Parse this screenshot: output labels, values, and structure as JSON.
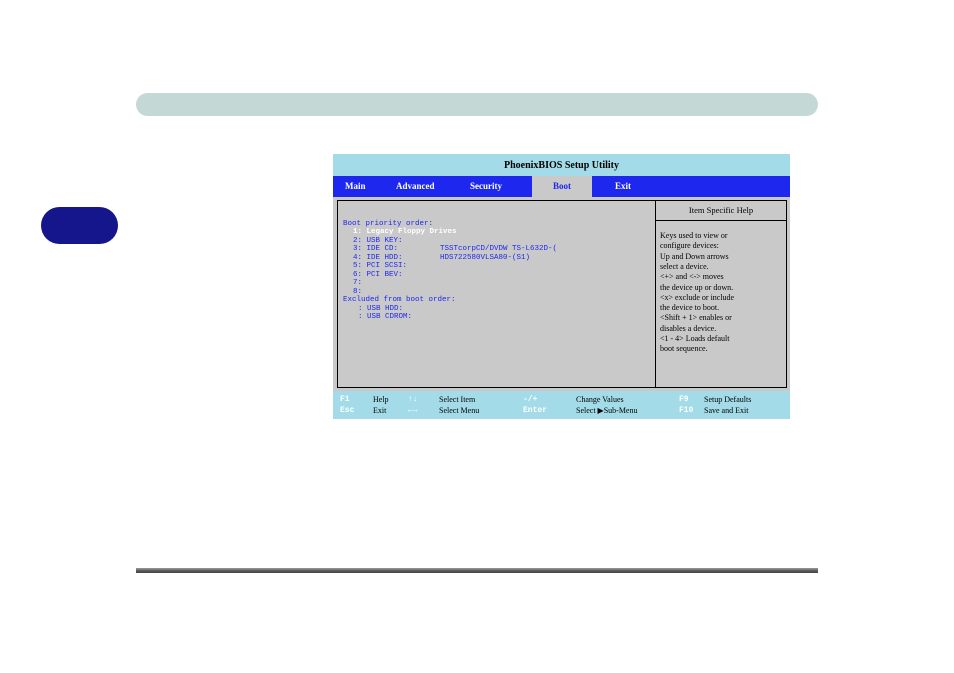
{
  "bios": {
    "title": "PhoenixBIOS Setup Utility",
    "menu": [
      {
        "label": "Main"
      },
      {
        "label": "Advanced"
      },
      {
        "label": "Security"
      },
      {
        "label": "Boot"
      },
      {
        "label": "Exit"
      }
    ],
    "active_menu": "Boot",
    "boot": {
      "priority_header": "Boot priority order:",
      "items": [
        {
          "label": "1:  Legacy Floppy Drives",
          "value": ""
        },
        {
          "label": "2:  USB KEY:",
          "value": ""
        },
        {
          "label": "3:  IDE CD:",
          "value": "TSSTcorpCD/DVDW TS-L632D-("
        },
        {
          "label": "4:  IDE HDD:",
          "value": "HDS722580VLSA80-(S1)"
        },
        {
          "label": "5:  PCI SCSI:",
          "value": ""
        },
        {
          "label": "6:  PCI BEV:",
          "value": ""
        },
        {
          "label": "7:",
          "value": ""
        },
        {
          "label": "8:",
          "value": ""
        }
      ],
      "excluded_header": "Excluded from boot order:",
      "excluded": [
        {
          "label": ":  USB HDD:"
        },
        {
          "label": ":  USB CDROM:"
        }
      ]
    },
    "help": {
      "header": "Item Specific Help",
      "lines": [
        "Keys used to view or",
        "configure devices:",
        "Up and Down arrows",
        "select a device.",
        "<+> and <-> moves",
        "the device up or down.",
        "<x> exclude or include",
        "the device to boot.",
        "<Shift + 1> enables or",
        "disables a device.",
        "<1 - 4> Loads default",
        "boot sequence."
      ]
    },
    "footer": {
      "row1": [
        {
          "key": "F1",
          "text": "Help"
        },
        {
          "key": "↑↓",
          "text": "Select Item"
        },
        {
          "key": "-/+",
          "text": "Change Values"
        },
        {
          "key": "F9",
          "text": "Setup Defaults"
        }
      ],
      "row2": [
        {
          "key": "Esc",
          "text": "Exit"
        },
        {
          "key": "←→",
          "text": "Select Menu"
        },
        {
          "key": "Enter",
          "text": "Select ▶Sub-Menu"
        },
        {
          "key": "F10",
          "text": "Save and Exit"
        }
      ]
    }
  },
  "colors": {
    "menu_bar": "#1d27ee",
    "title_bar": "#a3dce8",
    "panel": "#c9c9c9",
    "chapter_tab": "#15168c",
    "top_bar": "#c4d9d5"
  }
}
